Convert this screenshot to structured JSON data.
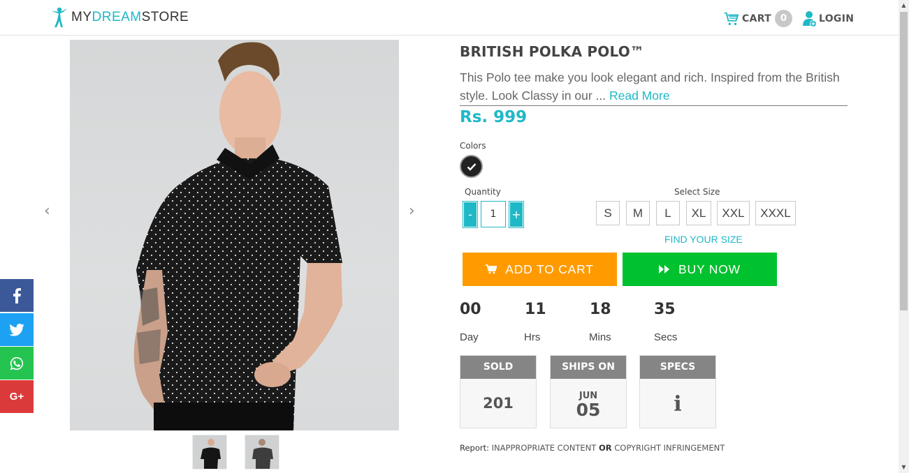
{
  "header": {
    "logo_prefix": "MY",
    "logo_accent": "DREAM",
    "logo_suffix": "STORE",
    "cart_label": "CART",
    "cart_count": "0",
    "login_label": "LOGIN"
  },
  "gallery": {
    "prev_arrow": "‹",
    "next_arrow": "›"
  },
  "product": {
    "title": "BRITISH POLKA POLO™",
    "description": "This Polo tee make you look elegant and rich. Inspired from the British style.  Look Classy in our ... ",
    "read_more": "Read More",
    "price": "Rs. 999",
    "colors_label": "Colors",
    "selected_color": "#222222",
    "quantity_label": "Quantity",
    "quantity_minus": "-",
    "quantity_plus": "+",
    "quantity_value": "1",
    "size_label": "Select Size",
    "sizes": [
      "S",
      "M",
      "L",
      "XL",
      "XXL",
      "XXXL"
    ],
    "find_size": "FIND YOUR SIZE",
    "add_to_cart": "ADD TO CART",
    "buy_now": "BUY NOW"
  },
  "countdown": {
    "days": "00",
    "days_label": "Day",
    "hours": "11",
    "hours_label": "Hrs",
    "mins": "18",
    "mins_label": "Mins",
    "secs": "35",
    "secs_label": "Secs"
  },
  "info": {
    "sold_label": "SOLD",
    "sold_value": "201",
    "ships_label": "SHIPS ON",
    "ships_month": "JUN",
    "ships_day": "05",
    "specs_label": "SPECS",
    "specs_icon": "i"
  },
  "report": {
    "prefix": "Report:",
    "link1": "INAPPROPRIATE CONTENT",
    "or": "OR",
    "link2": "COPYRIGHT INFRINGEMENT"
  },
  "colors": {
    "accent": "#1fb8c6",
    "add_to_cart": "#ff9a00",
    "buy_now": "#00c12e",
    "facebook": "#3b5998",
    "twitter": "#1da1f2",
    "whatsapp": "#25c450",
    "googleplus": "#db3a3a"
  },
  "social_icons": [
    "facebook-icon",
    "twitter-icon",
    "whatsapp-icon",
    "google-plus-icon"
  ],
  "social": {
    "googleplus_text": "G+"
  }
}
